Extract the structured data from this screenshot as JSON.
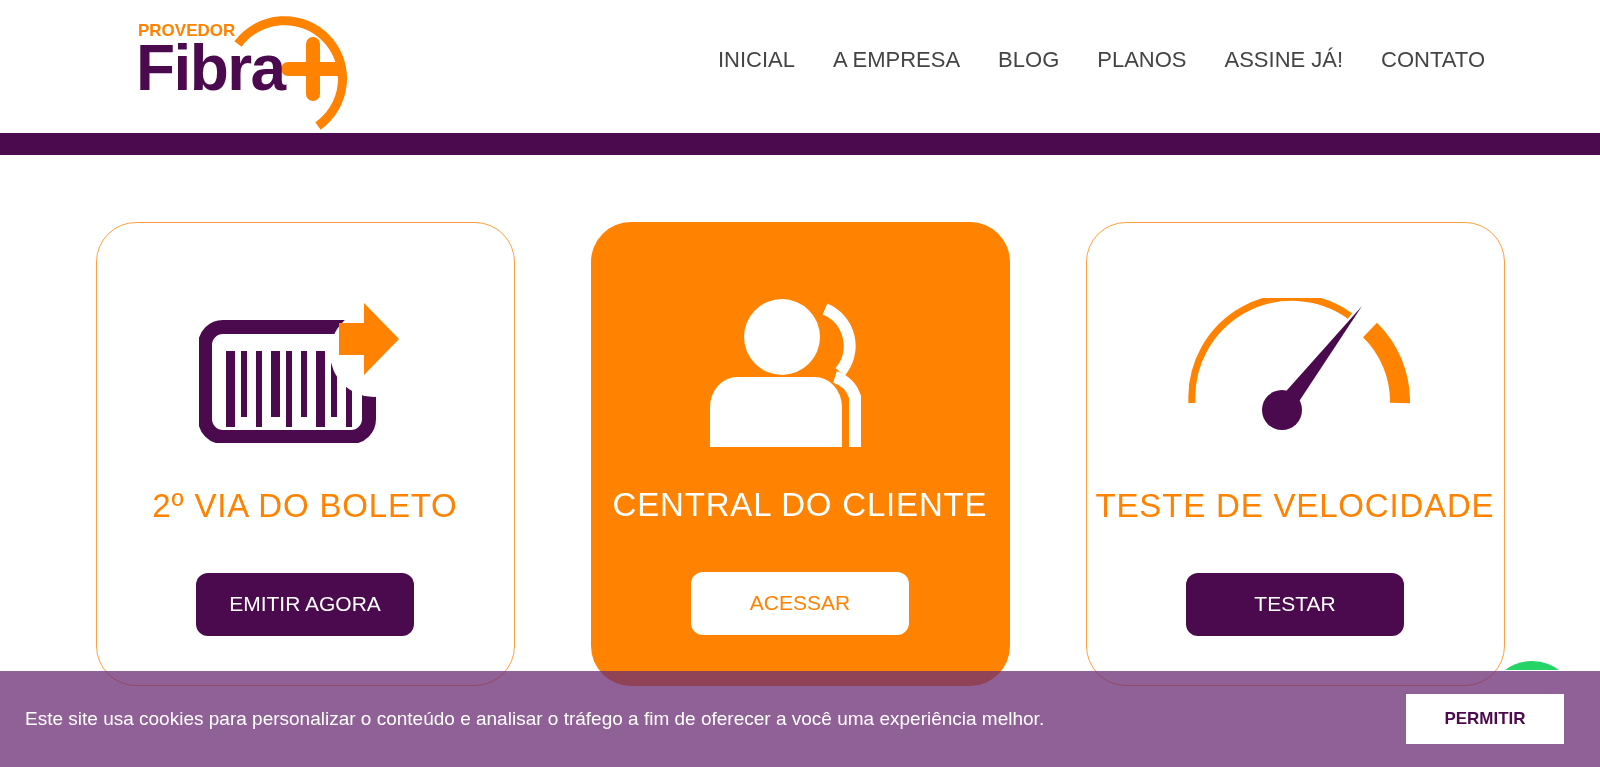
{
  "logo": {
    "tagline": "PROVEDOR",
    "name": "Fibra"
  },
  "nav": [
    {
      "label": "INICIAL"
    },
    {
      "label": "A EMPRESA"
    },
    {
      "label": "BLOG"
    },
    {
      "label": "PLANOS"
    },
    {
      "label": "ASSINE JÁ!"
    },
    {
      "label": "CONTATO"
    }
  ],
  "cards": [
    {
      "kind": "outline",
      "title": "2º VIA DO BOLETO",
      "button": "EMITIR AGORA"
    },
    {
      "kind": "filled",
      "title": "CENTRAL DO CLIENTE",
      "button": "ACESSAR"
    },
    {
      "kind": "outline",
      "title": "TESTE DE VELOCIDADE",
      "button": "TESTAR"
    }
  ],
  "cookie_banner": {
    "message": "Este site usa cookies para personalizar o conteúdo e analisar o tráfego a fim de oferecer a você uma experiência melhor.",
    "button": "PERMITIR"
  }
}
